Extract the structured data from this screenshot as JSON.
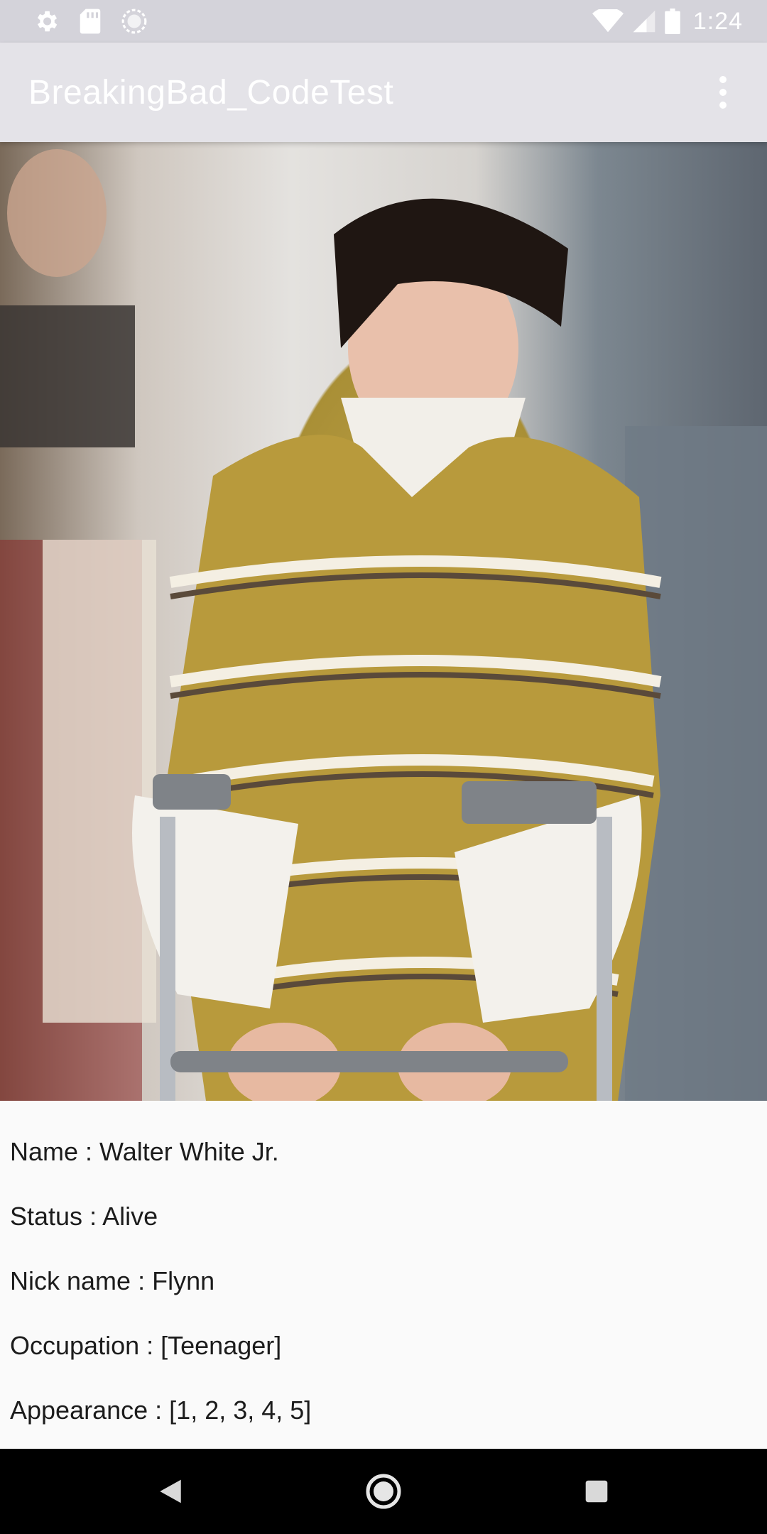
{
  "status_bar": {
    "time": "1:24",
    "left_icons": [
      "settings-icon",
      "sd-card-icon",
      "sync-icon"
    ],
    "right_icons": [
      "wifi-icon",
      "cell-signal-icon",
      "battery-icon"
    ]
  },
  "app_bar": {
    "title": "BreakingBad_CodeTest",
    "overflow_icon": "more-vert-icon"
  },
  "character": {
    "name_label": "Name",
    "name": "Walter White Jr.",
    "status_label": "Status",
    "status": "Alive",
    "nickname_label": "Nick name",
    "nickname": "Flynn",
    "occupation_label": "Occupation",
    "occupation": "[Teenager]",
    "appearance_label": "Appearance",
    "appearance": "[1, 2, 3, 4, 5]"
  },
  "nav_bar": {
    "buttons": [
      "back-icon",
      "home-icon",
      "recents-icon"
    ]
  },
  "colors": {
    "status_bar": "#d4d3da",
    "app_bar": "#e4e3e8",
    "title_text": "#ffffff",
    "background": "#fafafa",
    "nav_bar": "#000000"
  }
}
